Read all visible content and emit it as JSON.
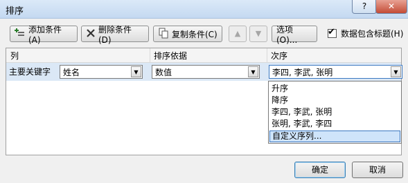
{
  "window": {
    "title": "排序",
    "help": "?",
    "close": "✕"
  },
  "toolbar": {
    "add_label": "添加条件(A)",
    "delete_label": "删除条件(D)",
    "copy_label": "复制条件(C)",
    "move_up": "▲",
    "move_down": "▼",
    "options_label": "选项(O)...",
    "header_checkbox_label": "数据包含标题(H)",
    "header_checkbox_checked": true
  },
  "grid": {
    "columns": [
      "列",
      "排序依据",
      "次序"
    ],
    "rows": [
      {
        "label": "主要关键字",
        "column": "姓名",
        "sort_on": "数值",
        "order": "李四, 李武, 张明"
      }
    ]
  },
  "order_dropdown": {
    "options": [
      "升序",
      "降序",
      "李四, 李武, 张明",
      "张明, 李武, 李四",
      "自定义序列..."
    ],
    "highlighted": "自定义序列..."
  },
  "buttons": {
    "ok": "确定",
    "cancel": "取消"
  },
  "colors": {
    "selection_bg": "#cfe4fa",
    "selection_border": "#3b78c1",
    "row_bg": "#dbe8f6"
  }
}
